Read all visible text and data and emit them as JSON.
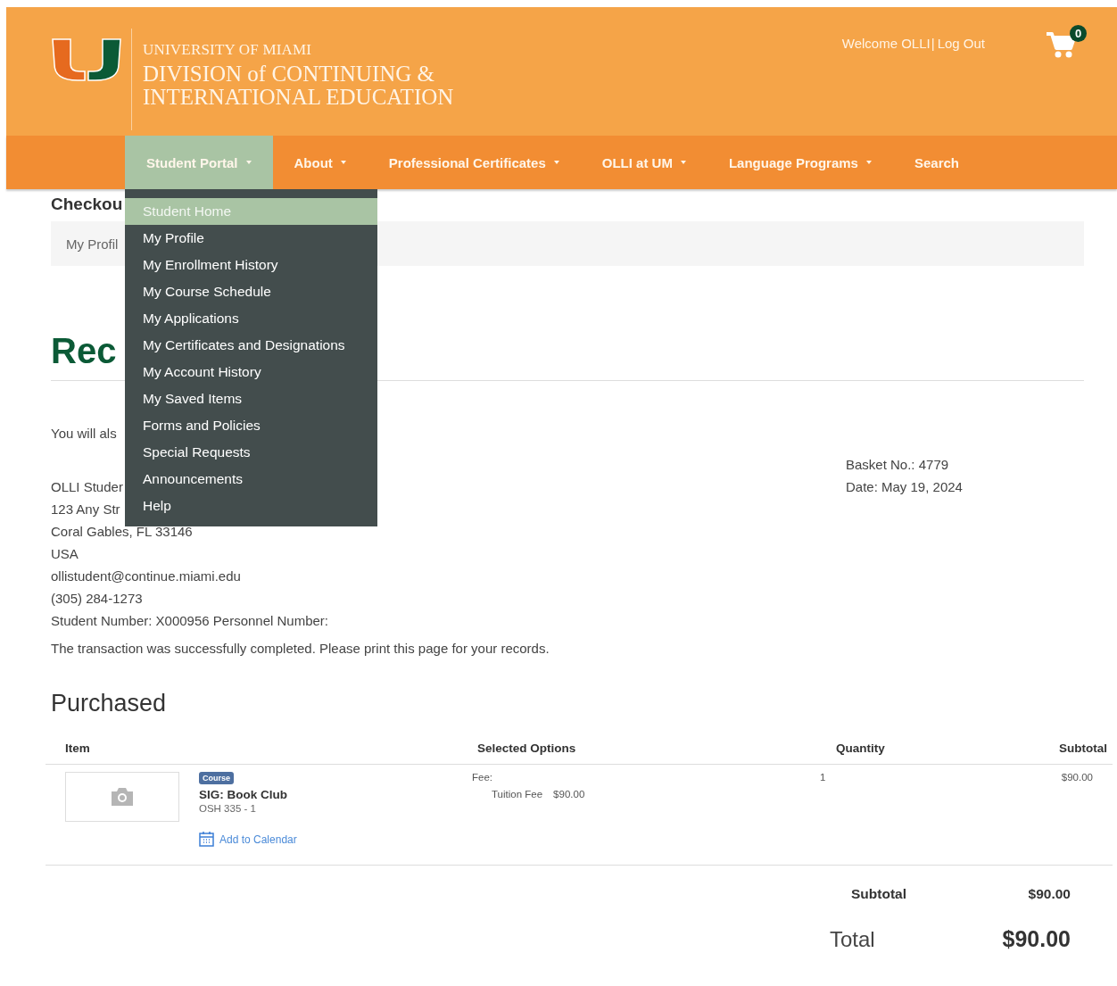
{
  "header": {
    "university": "UNIVERSITY OF MIAMI",
    "division_line_1": "DIVISION of CONTINUING &",
    "division_line_2": "INTERNATIONAL EDUCATION",
    "welcome": "Welcome OLLI",
    "separator": "|",
    "logout": "Log Out",
    "cart_count": "0"
  },
  "nav": [
    {
      "label": "Student Portal",
      "dropdown": true,
      "selected": true
    },
    {
      "label": "About",
      "dropdown": true,
      "selected": false
    },
    {
      "label": "Professional Certificates",
      "dropdown": true,
      "selected": false
    },
    {
      "label": "OLLI at UM",
      "dropdown": true,
      "selected": false
    },
    {
      "label": "Language Programs",
      "dropdown": true,
      "selected": false
    },
    {
      "label": "Search",
      "dropdown": false,
      "selected": false
    }
  ],
  "menu": [
    {
      "label": "Student Home",
      "selected": true
    },
    {
      "label": "My Profile",
      "selected": false
    },
    {
      "label": "My Enrollment History",
      "selected": false
    },
    {
      "label": "My Course Schedule",
      "selected": false
    },
    {
      "label": "My Applications",
      "selected": false
    },
    {
      "label": "My Certificates and Designations",
      "selected": false
    },
    {
      "label": "My Account History",
      "selected": false
    },
    {
      "label": "My Saved Items",
      "selected": false
    },
    {
      "label": "Forms and Policies",
      "selected": false
    },
    {
      "label": "Special Requests",
      "selected": false
    },
    {
      "label": "Announcements",
      "selected": false
    },
    {
      "label": "Help",
      "selected": false
    }
  ],
  "page_title": "Checkou",
  "breadcrumb": "My Profil",
  "receipt_heading": "Rec",
  "note": "You will als",
  "basket": {
    "number": "Basket No.: 4779",
    "date": "Date: May 19, 2024"
  },
  "address": [
    "OLLI Studer",
    "123 Any Str",
    "Coral Gables, FL 33146",
    "USA",
    "ollistudent@continue.miami.edu",
    "(305) 284-1273",
    "Student Number: X000956 Personnel Number:"
  ],
  "message": "The transaction was successfully completed. Please print this page for your records.",
  "purchased": {
    "heading": "Purchased",
    "columns": [
      "Item",
      "Selected Options",
      "Quantity",
      "Subtotal"
    ],
    "rows": [
      {
        "badge": "Course",
        "title": "SIG: Book Club",
        "code": "OSH 335 - 1",
        "calendar_link": "Add to Calendar",
        "options_label": "Fee:",
        "fee_name": "Tuition Fee",
        "fee_amount": "$90.00",
        "quantity": "1",
        "subtotal": "$90.00"
      }
    ]
  },
  "totals": [
    {
      "kind": "subtotal",
      "label": "Subtotal",
      "value": "$90.00"
    },
    {
      "kind": "total",
      "label": "Total",
      "value": "$90.00"
    }
  ]
}
